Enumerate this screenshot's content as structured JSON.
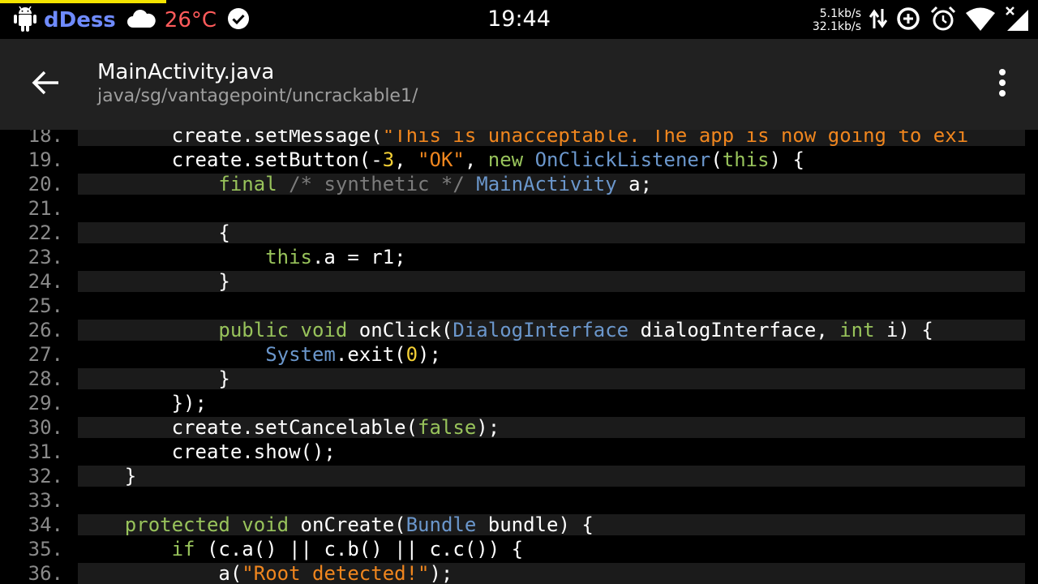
{
  "status_bar": {
    "app_name": "dDess",
    "temperature": "26°C",
    "time": "19:44",
    "upload_speed": "5.1kb/s",
    "download_speed": "32.1kb/s",
    "icons": [
      "android-icon",
      "cloud-icon",
      "check-circle-icon",
      "data-transfer-icon",
      "data-saver-icon",
      "alarm-icon",
      "wifi-icon",
      "signal-no-data-icon"
    ],
    "colors": {
      "app_name": "#6f8bff",
      "temperature": "#ff5b5b",
      "strip": "#f4e400"
    }
  },
  "toolbar": {
    "back_icon": "arrow-back-icon",
    "title": "MainActivity.java",
    "path": "java/sg/vantagepoint/uncrackable1/",
    "menu_icon": "more-vert-icon",
    "background": "#212121"
  },
  "code": {
    "colors": {
      "keyword": "#98c35b",
      "type": "#6b97cc",
      "string": "#f0861e",
      "number": "#f3cf35",
      "comment": "#7c7c7c",
      "plain": "#ffffff",
      "line_number": "#8a8a8a"
    },
    "lines": [
      {
        "n": "18.",
        "tokens": [
          [
            "        create.setMessage(",
            ""
          ],
          [
            "\"This is unacceptable. The app is now going to exi",
            "st"
          ]
        ]
      },
      {
        "n": "19.",
        "tokens": [
          [
            "        create.setButton(-",
            ""
          ],
          [
            "3",
            "nu"
          ],
          [
            ", ",
            ""
          ],
          [
            "\"OK\"",
            "st"
          ],
          [
            ", ",
            ""
          ],
          [
            "new",
            "kw"
          ],
          [
            " ",
            ""
          ],
          [
            "OnClickListener",
            "ty"
          ],
          [
            "(",
            ""
          ],
          [
            "this",
            "kw"
          ],
          [
            ") {",
            ""
          ]
        ]
      },
      {
        "n": "20.",
        "tokens": [
          [
            "            ",
            ""
          ],
          [
            "final",
            "kw"
          ],
          [
            " ",
            ""
          ],
          [
            "/* synthetic */",
            "cm"
          ],
          [
            " ",
            ""
          ],
          [
            "MainActivity",
            "ty"
          ],
          [
            " a;",
            ""
          ]
        ]
      },
      {
        "n": "21.",
        "tokens": []
      },
      {
        "n": "22.",
        "tokens": [
          [
            "            {",
            ""
          ]
        ]
      },
      {
        "n": "23.",
        "tokens": [
          [
            "                ",
            ""
          ],
          [
            "this",
            "kw"
          ],
          [
            ".a = r1;",
            ""
          ]
        ]
      },
      {
        "n": "24.",
        "tokens": [
          [
            "            }",
            ""
          ]
        ]
      },
      {
        "n": "25.",
        "tokens": []
      },
      {
        "n": "26.",
        "tokens": [
          [
            "            ",
            ""
          ],
          [
            "public",
            "kw"
          ],
          [
            " ",
            ""
          ],
          [
            "void",
            "kw"
          ],
          [
            " onClick(",
            ""
          ],
          [
            "DialogInterface",
            "ty"
          ],
          [
            " dialogInterface, ",
            ""
          ],
          [
            "int",
            "kw"
          ],
          [
            " i) {",
            ""
          ]
        ]
      },
      {
        "n": "27.",
        "tokens": [
          [
            "                ",
            ""
          ],
          [
            "System",
            "ty"
          ],
          [
            ".exit(",
            ""
          ],
          [
            "0",
            "nu"
          ],
          [
            ");",
            ""
          ]
        ]
      },
      {
        "n": "28.",
        "tokens": [
          [
            "            }",
            ""
          ]
        ]
      },
      {
        "n": "29.",
        "tokens": [
          [
            "        });",
            ""
          ]
        ]
      },
      {
        "n": "30.",
        "tokens": [
          [
            "        create.setCancelable(",
            ""
          ],
          [
            "false",
            "kw"
          ],
          [
            ");",
            ""
          ]
        ]
      },
      {
        "n": "31.",
        "tokens": [
          [
            "        create.show();",
            ""
          ]
        ]
      },
      {
        "n": "32.",
        "tokens": [
          [
            "    }",
            ""
          ]
        ]
      },
      {
        "n": "33.",
        "tokens": []
      },
      {
        "n": "34.",
        "tokens": [
          [
            "    ",
            ""
          ],
          [
            "protected",
            "kw"
          ],
          [
            " ",
            ""
          ],
          [
            "void",
            "kw"
          ],
          [
            " onCreate(",
            ""
          ],
          [
            "Bundle",
            "ty"
          ],
          [
            " bundle) {",
            ""
          ]
        ]
      },
      {
        "n": "35.",
        "tokens": [
          [
            "        ",
            ""
          ],
          [
            "if",
            "kw"
          ],
          [
            " (c.a() || c.b() || c.c()) {",
            ""
          ]
        ]
      },
      {
        "n": "36.",
        "tokens": [
          [
            "            a(",
            ""
          ],
          [
            "\"Root detected!\"",
            "st"
          ],
          [
            ");",
            ""
          ]
        ]
      }
    ]
  }
}
